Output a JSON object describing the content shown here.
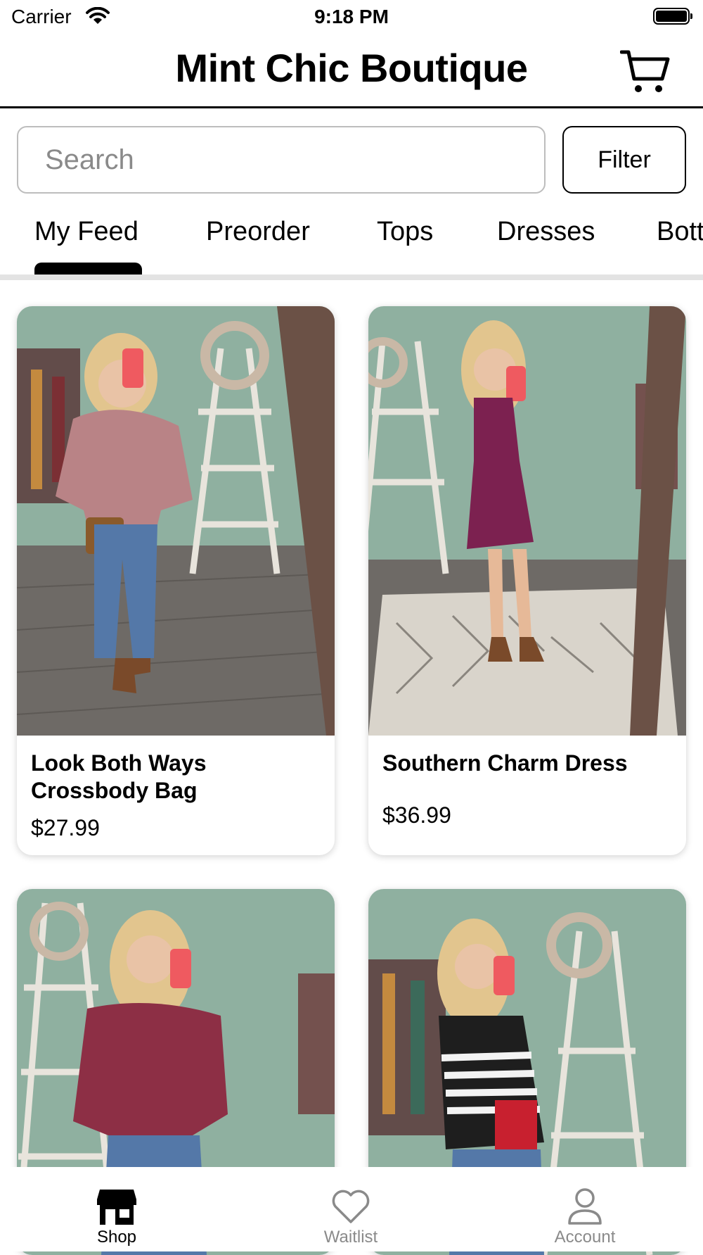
{
  "status_bar": {
    "carrier": "Carrier",
    "time": "9:18 PM"
  },
  "header": {
    "title": "Mint Chic Boutique"
  },
  "search": {
    "placeholder": "Search"
  },
  "filter": {
    "label": "Filter"
  },
  "tabs": [
    {
      "label": "My Feed",
      "selected": true
    },
    {
      "label": "Preorder"
    },
    {
      "label": "Tops"
    },
    {
      "label": "Dresses"
    },
    {
      "label": "Bott"
    }
  ],
  "products": [
    {
      "name": "Look Both Ways Crossbody Bag",
      "price": "$27.99"
    },
    {
      "name": "Southern Charm Dress",
      "price": "$36.99"
    },
    {
      "name": "",
      "price": ""
    },
    {
      "name": "",
      "price": ""
    }
  ],
  "bottom_nav": [
    {
      "label": "Shop",
      "icon": "storefront-icon",
      "selected": true
    },
    {
      "label": "Waitlist",
      "icon": "heart-icon"
    },
    {
      "label": "Account",
      "icon": "person-icon"
    }
  ],
  "colors": {
    "accent": "#000000",
    "inactive": "#8a8a8a",
    "wall": "#8fb0a0"
  }
}
